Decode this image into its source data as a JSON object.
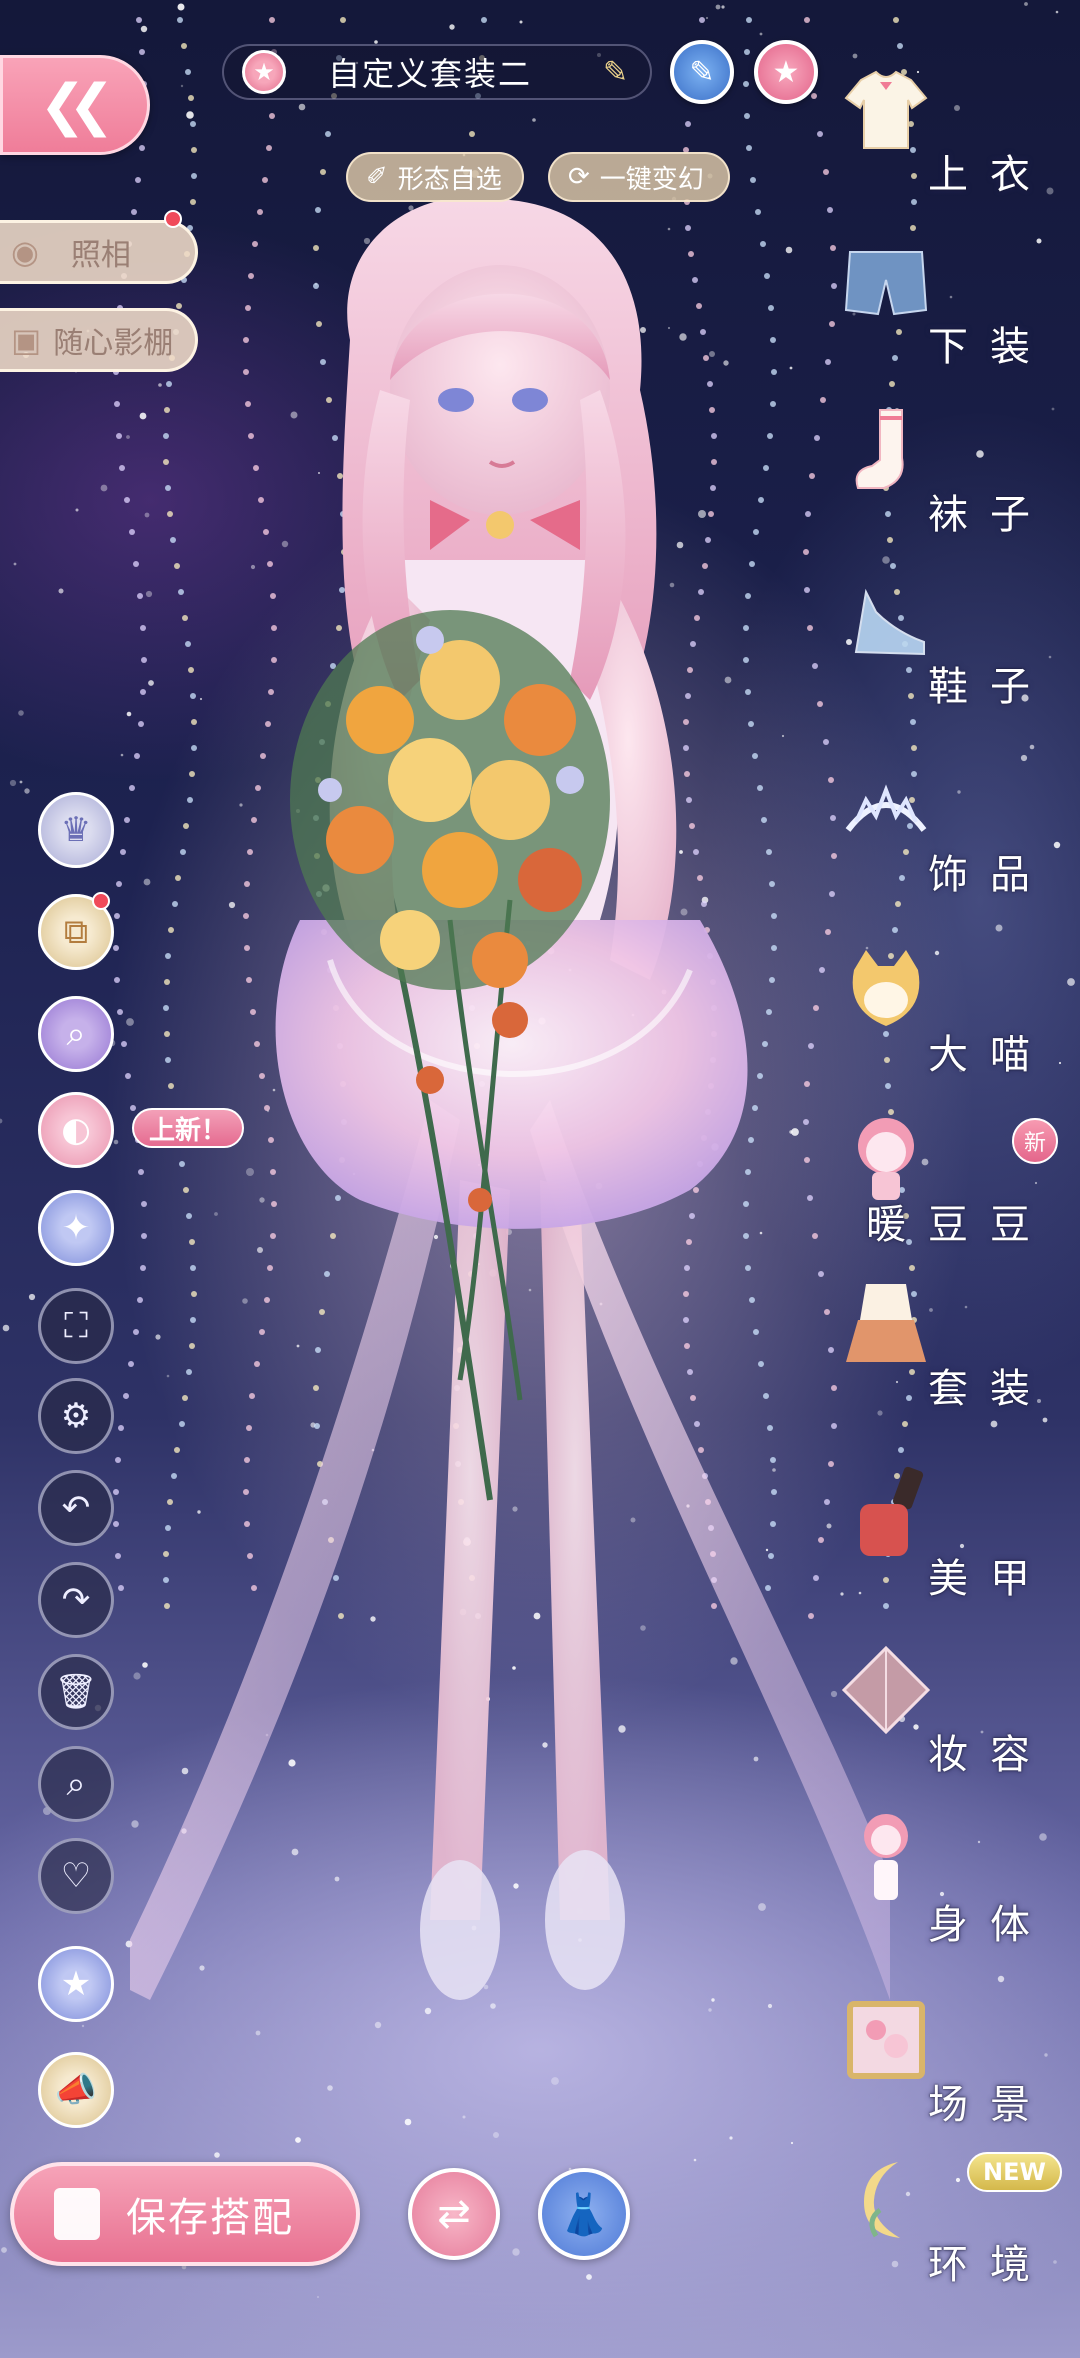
{
  "top_bar": {
    "back_icon": "double-chevron-left",
    "outfit_name": "自定义套装二",
    "pill_star_icon": "★",
    "edit_icon": "✎",
    "pen_icon": "✎",
    "favorite_icon": "★"
  },
  "chips": {
    "form_select": {
      "icon": "✐",
      "label": "形态自选"
    },
    "one_click_transform": {
      "icon": "⟳",
      "label": "一键变幻"
    }
  },
  "left_panel": {
    "photo": {
      "icon": "◉",
      "label": "照相"
    },
    "studio": {
      "icon": "▣",
      "label": "随心影棚"
    }
  },
  "tools": {
    "new_tag": "上新！",
    "icons": {
      "dress_preview": "♛",
      "layers": "⧉",
      "search_filter": "⌕",
      "palette": "◐",
      "magic_star": "✦",
      "fullscreen": "⛶",
      "settings": "⚙",
      "undo": "↶",
      "redo": "↷",
      "delete": "🗑",
      "zoom": "⌕",
      "heart": "♡",
      "star_badge": "★",
      "megaphone": "📣"
    }
  },
  "categories": [
    {
      "label": "上衣",
      "thumb": "shirt"
    },
    {
      "label": "下装",
      "thumb": "shorts"
    },
    {
      "label": "袜子",
      "thumb": "sock"
    },
    {
      "label": "鞋子",
      "thumb": "shoe"
    },
    {
      "label": "饰品",
      "thumb": "tiara"
    },
    {
      "label": "大喵",
      "thumb": "cat"
    },
    {
      "label": "暖豆豆",
      "thumb": "chibi",
      "badge": "新"
    },
    {
      "label": "套装",
      "thumb": "outfit-set"
    },
    {
      "label": "美甲",
      "thumb": "nail-polish"
    },
    {
      "label": "妆容",
      "thumb": "makeup-box"
    },
    {
      "label": "身体",
      "thumb": "body"
    },
    {
      "label": "场景",
      "thumb": "scene-frame"
    },
    {
      "label": "环境",
      "thumb": "moon",
      "badge": "NEW"
    }
  ],
  "bottom_bar": {
    "save_label": "保存搭配",
    "swap_icon": "⇄",
    "wardrobe_icon": "👗"
  },
  "colors": {
    "accent_pink": "#e87191",
    "chip_beige": "#d7c3a5",
    "new_badge": "#e4668b",
    "NEW_badge": "#d4b84b"
  }
}
